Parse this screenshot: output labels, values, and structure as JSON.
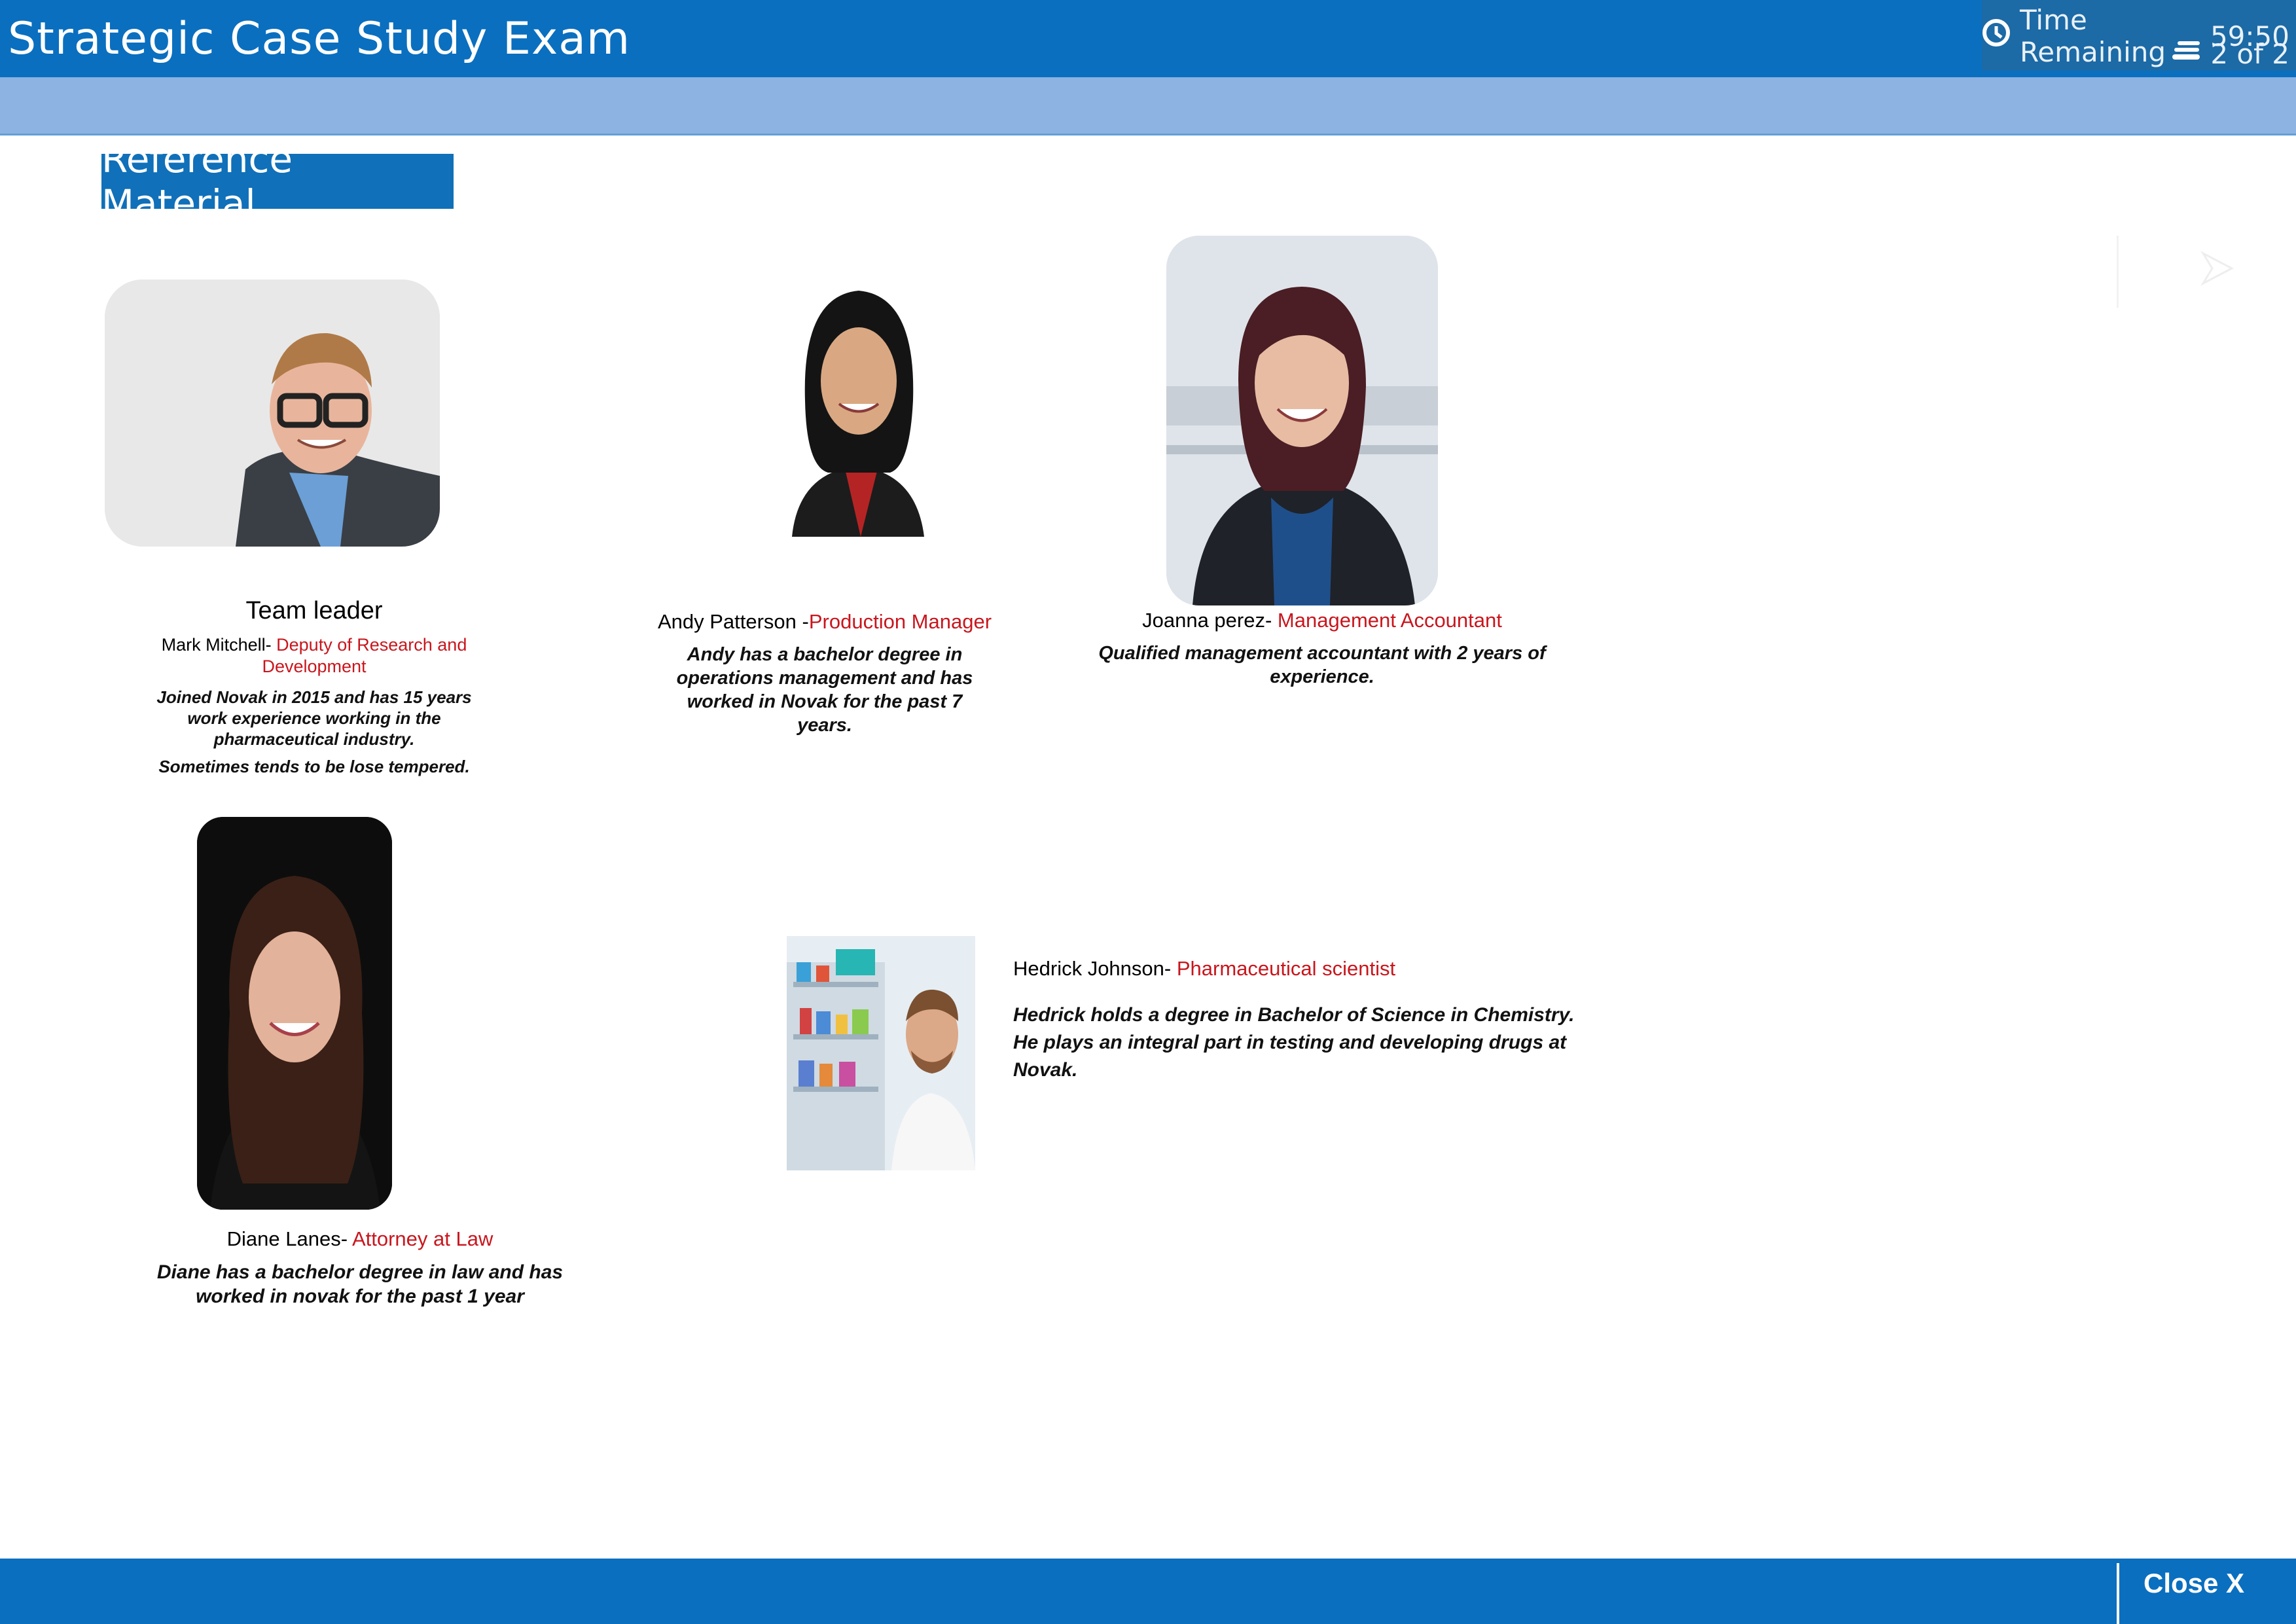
{
  "header": {
    "title": "Strategic Case Study Exam",
    "timer_label": "Time Remaining",
    "timer_value": "59:50",
    "page_indicator": "2 of 2"
  },
  "reference": {
    "tab_label": "Reference Material"
  },
  "people": [
    {
      "heading": "Team leader",
      "name": "Mark Mitchell- ",
      "role": "Deputy of Research and Development",
      "desc": "Joined Novak in 2015 and has 15 years work experience working in the pharmaceutical industry.",
      "note": "Sometimes tends to be lose tempered."
    },
    {
      "name": "Andy Patterson -",
      "role": "Production Manager",
      "desc": "Andy has a bachelor degree in operations management and has worked in Novak for the past 7 years."
    },
    {
      "name": "Joanna perez- ",
      "role": "Management Accountant",
      "desc": "Qualified management accountant with 2 years of experience."
    },
    {
      "name": "Diane Lanes- ",
      "role": "Attorney at Law",
      "desc": "Diane has a bachelor degree in law and has worked in novak for the past 1 year"
    },
    {
      "name": "Hedrick Johnson- ",
      "role": "Pharmaceutical scientist",
      "desc": "Hedrick holds a degree in Bachelor of Science in Chemistry.  He plays an integral part in testing and developing drugs at Novak."
    }
  ],
  "footer": {
    "close_label": "Close X"
  },
  "colors": {
    "header_blue": "#0a6fbf",
    "subbar_blue": "#8db3e2",
    "role_red": "#c8161d"
  }
}
